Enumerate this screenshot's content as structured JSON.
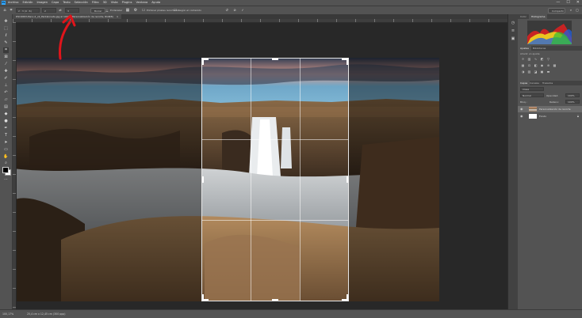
{
  "menubar": {
    "logo": "Ps",
    "items": [
      "Archivo",
      "Edición",
      "Imagen",
      "Capa",
      "Texto",
      "Selección",
      "Filtro",
      "3D",
      "Vista",
      "Plugins",
      "Ventana",
      "Ayuda"
    ],
    "window_controls": [
      "—",
      "☐",
      "✕"
    ]
  },
  "options": {
    "ratio_value": "2 : 3 (4 : 6)",
    "ratio_w": "2",
    "ratio_h": "3",
    "clear_label": "Borrar",
    "straighten_label": "Enderezar",
    "delete_pixels_label": "Eliminar píxeles recortados",
    "content_aware_label": "Según el contenido",
    "share_label": "Compartir"
  },
  "document": {
    "tab_title": "DSC4663-Pano-2_v2_Pantaloneta.jpg al 100% (Personalización de recorte, RGB/8)"
  },
  "statusbar": {
    "zoom": "100,17%",
    "info": "25,4 cm x 12,45 cm (300 ppp)"
  },
  "tools": {
    "icons": [
      "move-icon",
      "marquee-icon",
      "lasso-icon",
      "quick-select-icon",
      "crop-icon",
      "frame-icon",
      "eyedropper-icon",
      "healing-icon",
      "brush-icon",
      "clone-stamp-icon",
      "history-brush-icon",
      "eraser-icon",
      "gradient-icon",
      "blur-icon",
      "dodge-icon",
      "pen-icon",
      "type-icon",
      "path-select-icon",
      "rectangle-icon",
      "hand-icon",
      "zoom-icon",
      "more-tools-icon"
    ]
  },
  "panels": {
    "top_tabs": [
      "Color",
      "Histograma"
    ],
    "adjust_tabs": [
      "Ajustes",
      "Bibliotecas"
    ],
    "adjust_hint": "Añadir un ajuste",
    "layers_tabs": [
      "Capas",
      "Canales",
      "Trazados"
    ],
    "search_label": "Clase",
    "blend_mode": "Normal",
    "opacity_label": "Opacidad:",
    "opacity_value": "100%",
    "lock_label": "Bloq.:",
    "fill_label": "Relleno:",
    "fill_value": "100%",
    "layers": [
      {
        "name": "Personalización de recorte"
      },
      {
        "name": "Fondo"
      }
    ]
  }
}
